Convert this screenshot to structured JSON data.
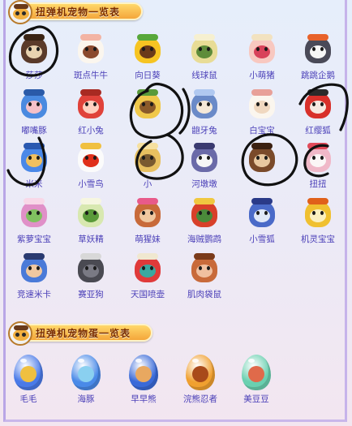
{
  "header": {
    "title": "扭弹机宠物一览表"
  },
  "pets": [
    {
      "name": "莎莎",
      "colors": [
        "#5a3a2a",
        "#e8d2b0",
        "#3a2414"
      ]
    },
    {
      "name": "斑点牛牛",
      "colors": [
        "#fbf6ee",
        "#8b4a2e",
        "#f3b4a4"
      ]
    },
    {
      "name": "向日葵",
      "colors": [
        "#f6c422",
        "#6a3a1a",
        "#58a83a"
      ]
    },
    {
      "name": "线球鼠",
      "colors": [
        "#e8dc96",
        "#5e8c3a",
        "#f6f0d0"
      ]
    },
    {
      "name": "小萌猪",
      "colors": [
        "#f8c8c0",
        "#d8425a",
        "#f2e2c0"
      ]
    },
    {
      "name": "跳跳企鹅",
      "colors": [
        "#4a4a58",
        "#f6f6f6",
        "#e8622a"
      ]
    },
    {
      "name": "嘟嘴豚",
      "colors": [
        "#4a8ae0",
        "#f4c0c8",
        "#2a5aa8"
      ]
    },
    {
      "name": "红小兔",
      "colors": [
        "#e0423a",
        "#ffd0c0",
        "#a82a22"
      ]
    },
    {
      "name": "",
      "colors": [
        "#f0c84a",
        "#8b5a2a",
        "#5a9a3a"
      ]
    },
    {
      "name": "龅牙兔",
      "colors": [
        "#6a8ac8",
        "#f4e8d8",
        "#b0c8f0"
      ]
    },
    {
      "name": "白宝宝",
      "colors": [
        "#fbf6ee",
        "#f0d8c0",
        "#e8a098"
      ]
    },
    {
      "name": "红缨狐",
      "colors": [
        "#d8302a",
        "#f6e8e0",
        "#2a2a2a"
      ]
    },
    {
      "name": "米米",
      "colors": [
        "#4a88e8",
        "#f0c060",
        "#2a58b0"
      ]
    },
    {
      "name": "小雪鸟",
      "colors": [
        "#fbfbfb",
        "#e0301a",
        "#f0c040"
      ]
    },
    {
      "name": "小",
      "colors": [
        "#e8c060",
        "#7a5a30",
        "#f6e0a0"
      ]
    },
    {
      "name": "河墩墩",
      "colors": [
        "#6a6aa8",
        "#f6f6f6",
        "#3a3a70"
      ]
    },
    {
      "name": "",
      "colors": [
        "#7a4a2a",
        "#e8c8a0",
        "#3a2010"
      ]
    },
    {
      "name": "扭扭",
      "colors": [
        "#f0b8c8",
        "#fbf6f6",
        "#e04a5a"
      ]
    },
    {
      "name": "紫萝宝宝",
      "colors": [
        "#e090c8",
        "#80c060",
        "#f8d8e8"
      ]
    },
    {
      "name": "草妖精",
      "colors": [
        "#d8e8b0",
        "#5a9a3a",
        "#f6f6e0"
      ]
    },
    {
      "name": "萌猩妹",
      "colors": [
        "#c86a3a",
        "#f0c8a0",
        "#e85a8a"
      ]
    },
    {
      "name": "海贼鹦鹉",
      "colors": [
        "#d8402a",
        "#4a8a3a",
        "#f0c840"
      ]
    },
    {
      "name": "小雪狐",
      "colors": [
        "#4a6ac8",
        "#e0e8f8",
        "#2a3a88"
      ]
    },
    {
      "name": "机灵宝宝",
      "colors": [
        "#f0c030",
        "#fbf0c0",
        "#e0601a"
      ]
    },
    {
      "name": "竞速米卡",
      "colors": [
        "#4a7ad8",
        "#f0c8a0",
        "#2a3a70"
      ]
    },
    {
      "name": "赛亚狗",
      "colors": [
        "#4a4a52",
        "#7a7a84",
        "#d8d8d8"
      ]
    },
    {
      "name": "天国喷壶",
      "colors": [
        "#e03a3a",
        "#3aa8a0",
        "#f0e8d0"
      ]
    },
    {
      "name": "肌肉袋鼠",
      "colors": [
        "#c86a3a",
        "#f0c0a0",
        "#7a3a1a"
      ]
    }
  ],
  "egg_section": {
    "title": "扭弹机宠物蛋一览表",
    "eggs": [
      {
        "name": "毛毛",
        "colors": [
          "#4a7ae8",
          "#f0c040"
        ]
      },
      {
        "name": "海豚",
        "colors": [
          "#4a8ae8",
          "#8ad0f0"
        ]
      },
      {
        "name": "早早熊",
        "colors": [
          "#3a6ad8",
          "#e8a860"
        ]
      },
      {
        "name": "浣熊忍者",
        "colors": [
          "#f0a030",
          "#a84a1a"
        ]
      },
      {
        "name": "美豆豆",
        "colors": [
          "#6ad0b0",
          "#e06a4a"
        ]
      }
    ]
  }
}
